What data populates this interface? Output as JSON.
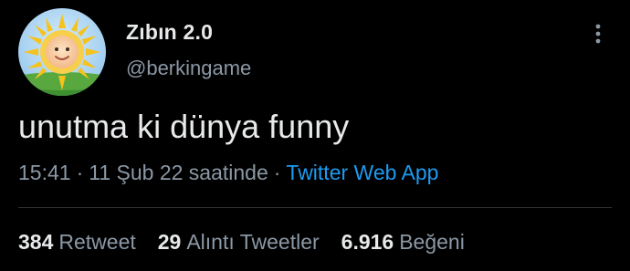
{
  "author": {
    "display_name": "Zıbın 2.0",
    "handle": "@berkingame"
  },
  "tweet": {
    "text": "unutma ki dünya funny",
    "time": "15:41",
    "date": "11 Şub 22 saatinde",
    "separator": "·",
    "source": "Twitter Web App"
  },
  "stats": {
    "retweets": {
      "count": "384",
      "label": "Retweet"
    },
    "quotes": {
      "count": "29",
      "label": "Alıntı Tweetler"
    },
    "likes": {
      "count": "6.916",
      "label": "Beğeni"
    }
  },
  "icons": {
    "more": "more-vertical-icon",
    "avatar": "sun-baby-avatar"
  },
  "colors": {
    "background": "#000000",
    "text": "#e7e9ea",
    "secondary": "#8b98a5",
    "link": "#1d9bf0",
    "divider": "#2f3336"
  }
}
